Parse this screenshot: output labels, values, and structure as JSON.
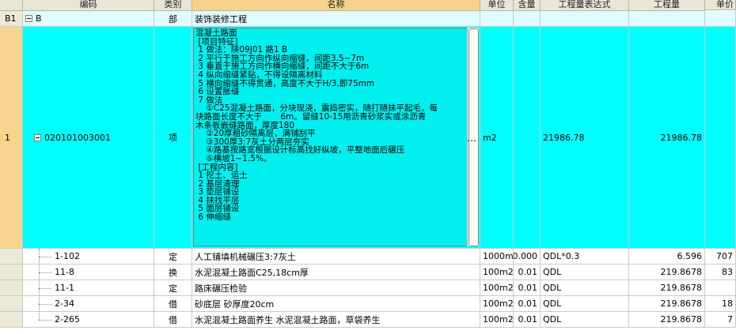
{
  "headers": [
    "编码",
    "类别",
    "名称",
    "单位",
    "含量",
    "工程量表达式",
    "工程量",
    "单价"
  ],
  "group_row": {
    "rownum": "B1",
    "code": "B",
    "type": "部",
    "name": "装饰装修工程"
  },
  "main_row": {
    "rownum": "1",
    "code": "020101003001",
    "type": "项",
    "unit": "m2",
    "expr": "21986.78",
    "qty": "21986.78",
    "ellipsis": "…",
    "description": [
      "混凝土路面",
      " [项目特征]",
      " 1 做法：陕09J01 路1 B",
      " 2 平行于施工方向作纵向缩缝，间距3.5~7m",
      " 3 垂直于施工方向作横向缩缝，间距不大于6m",
      " 4 纵向缩缝紧贴，不得设隔离材料",
      " 5 横向缩缝不得贯通，高度不大于H/3,即75mm",
      " 6 设置胀缝",
      " 7 做法",
      "    ①C25混凝土路面，分块现浇，震捣密实，随打随抹平起毛，每",
      "块路面长度不大于       6m。留缝10-15用沥青砂浆实或涂沥青",
      "木条板嵌缝路面，厚度180",
      "    ②20厚粗砂隔离层，满铺刮平",
      "    ③300厚3:7灰土分两层夯实",
      "    ④路基按路宽根据设计标高找好纵坡，平整地面后碾压",
      "    ⑤横坡1~1.5%。",
      " [工程内容]",
      " 1 挖土、运土",
      " 2 基层清理",
      " 3 垫层铺设",
      " 4 抹找平层",
      " 5 面层铺设",
      " 6 伸缩缝"
    ]
  },
  "sub_rows": [
    {
      "code": "1-102",
      "type": "定",
      "name": "人工铺填机械碾压3:7灰土",
      "unit": "1000m3",
      "content": "0.000",
      "expr": "QDL*0.3",
      "qty": "6.596",
      "price": "707"
    },
    {
      "code": "11-8",
      "type": "换",
      "name": "水泥混凝土路面C25,18cm厚",
      "unit": "100m2",
      "content": "0.01",
      "expr": "QDL",
      "qty": "219.8678",
      "price": "83"
    },
    {
      "code": "11-1",
      "type": "定",
      "name": "路床碾压检验",
      "unit": "100m2",
      "content": "0.01",
      "expr": "QDL",
      "qty": "219.8678",
      "price": ""
    },
    {
      "code": "2-34",
      "type": "借",
      "name": "砂底层 砂厚度20cm",
      "unit": "100m2",
      "content": "0.01",
      "expr": "QDL",
      "qty": "219.8678",
      "price": "18"
    },
    {
      "code": "2-265",
      "type": "借",
      "name": "水泥混凝土路面养生 水泥混凝土路面，草袋养生",
      "unit": "100m2",
      "content": "0.01",
      "expr": "QDL",
      "qty": "219.8678",
      "price": "7"
    }
  ]
}
